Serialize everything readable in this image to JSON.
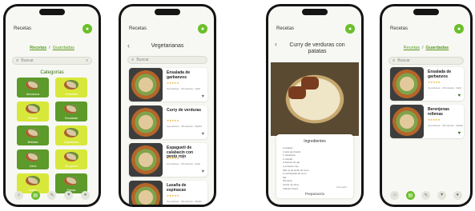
{
  "colors": {
    "accent": "#6cbf2c",
    "accent_dark": "#3d6f16",
    "tile_green": "#5c9a2a",
    "tile_lime": "#d8e83a"
  },
  "app": {
    "title": "Recetas"
  },
  "toggle": {
    "left": "Recetas",
    "separator": "/",
    "right": "Guardadas"
  },
  "search": {
    "placeholder": "Buscar"
  },
  "categories": {
    "heading": "Categorías",
    "items": [
      {
        "label": "Almuerzos",
        "color": "#5c9a2a"
      },
      {
        "label": "Entrantes",
        "color": "#d8e83a"
      },
      {
        "label": "Postres",
        "color": "#d8e83a"
      },
      {
        "label": "Ensaladas",
        "color": "#5c9a2a"
      },
      {
        "label": "Bebidas",
        "color": "#5c9a2a"
      },
      {
        "label": "Vegetariano",
        "color": "#d8e83a"
      },
      {
        "label": "Cena",
        "color": "#5c9a2a"
      },
      {
        "label": "Sin gluten",
        "color": "#d8e83a"
      },
      {
        "label": "Sopas",
        "color": "#d8e83a"
      },
      {
        "label": "Pastas",
        "color": "#5c9a2a"
      }
    ]
  },
  "nav": {
    "items": [
      "home-icon",
      "book-icon",
      "recipe-icon",
      "heart-icon",
      "user-icon"
    ]
  },
  "vegetarian": {
    "title": "Vegetarianas",
    "cards": [
      {
        "title": "Ensalada de garbanzos",
        "stars": "★★★★★",
        "meta": "3 porciones · 20 minutos · Fácil"
      },
      {
        "title": "Curry de verduras",
        "stars": "★★★★★",
        "meta": "4 porciones · 35 minutos · Media"
      },
      {
        "title": "Espagueti de calabacín con pesto rojo",
        "stars": "★★★★★",
        "meta": "2 porciones · 25 minutos · Fácil"
      },
      {
        "title": "Lasaña de espinacas",
        "stars": "★★★★★",
        "meta": "6 porciones · 60 minutos · Media"
      }
    ]
  },
  "detail": {
    "title": "Curry de verduras con patatas",
    "ingredients_heading": "Ingredientes",
    "ingredients": [
      "2 patatas",
      "1 taza de brócoli",
      "1 zanahoria",
      "1 cebolla",
      "2 dientes de ajo",
      "1 pimiento rojo",
      "400 ml de leche de coco",
      "2 cucharadas de curry",
      "Sal",
      "Pimienta",
      "Aceite de oliva",
      "Cilantro fresco"
    ],
    "share": "Compartir",
    "footer": "Preparación"
  },
  "saved": {
    "cards": [
      {
        "title": "Ensalada de garbanzos",
        "stars": "★★★★★",
        "meta": "3 porciones · 20 minutos · Fácil"
      },
      {
        "title": "Berenjenas rellenas",
        "stars": "★★★★★",
        "meta": "4 porciones · 45 minutos · Media"
      }
    ]
  }
}
